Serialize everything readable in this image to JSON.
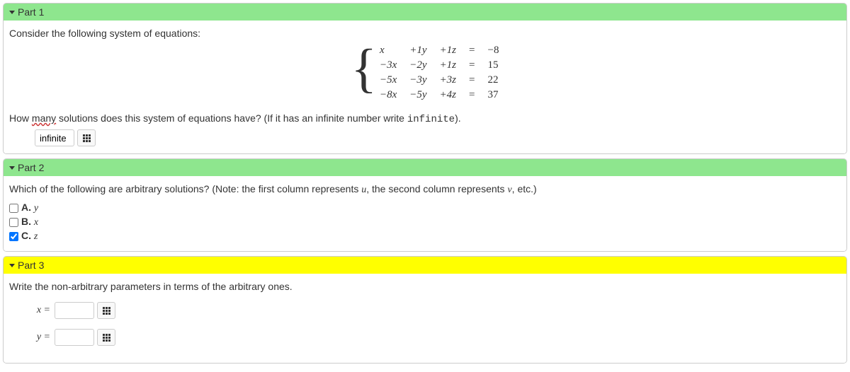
{
  "part1": {
    "title": "Part 1",
    "prompt": "Consider the following system of equations:",
    "equations": [
      {
        "c1": "x",
        "c2": "+1y",
        "c3": "+1z",
        "op": "=",
        "rhs": "−8"
      },
      {
        "c1": "−3x",
        "c2": "−2y",
        "c3": "+1z",
        "op": "=",
        "rhs": "15"
      },
      {
        "c1": "−5x",
        "c2": "−3y",
        "c3": "+3z",
        "op": "=",
        "rhs": "22"
      },
      {
        "c1": "−8x",
        "c2": "−5y",
        "c3": "+4z",
        "op": "=",
        "rhs": "37"
      }
    ],
    "question_pre": "How ",
    "question_underlined": "many",
    "question_post": " solutions does this system of equations have? (If it has an infinite number write ",
    "question_code": "infinite",
    "question_end": ").",
    "answer_value": "infinite"
  },
  "part2": {
    "title": "Part 2",
    "prompt_pre": "Which of the following are arbitrary solutions? (Note: the first column represents ",
    "prompt_u": "u",
    "prompt_mid": ", the second column represents ",
    "prompt_v": "v",
    "prompt_post": ", etc.)",
    "options": [
      {
        "letter": "A.",
        "var": "y",
        "checked": false
      },
      {
        "letter": "B.",
        "var": "x",
        "checked": false
      },
      {
        "letter": "C.",
        "var": "z",
        "checked": true
      }
    ]
  },
  "part3": {
    "title": "Part 3",
    "prompt": "Write the non-arbitrary parameters in terms of the arbitrary ones.",
    "params": [
      {
        "lhs": "x =",
        "value": ""
      },
      {
        "lhs": "y =",
        "value": ""
      }
    ]
  }
}
